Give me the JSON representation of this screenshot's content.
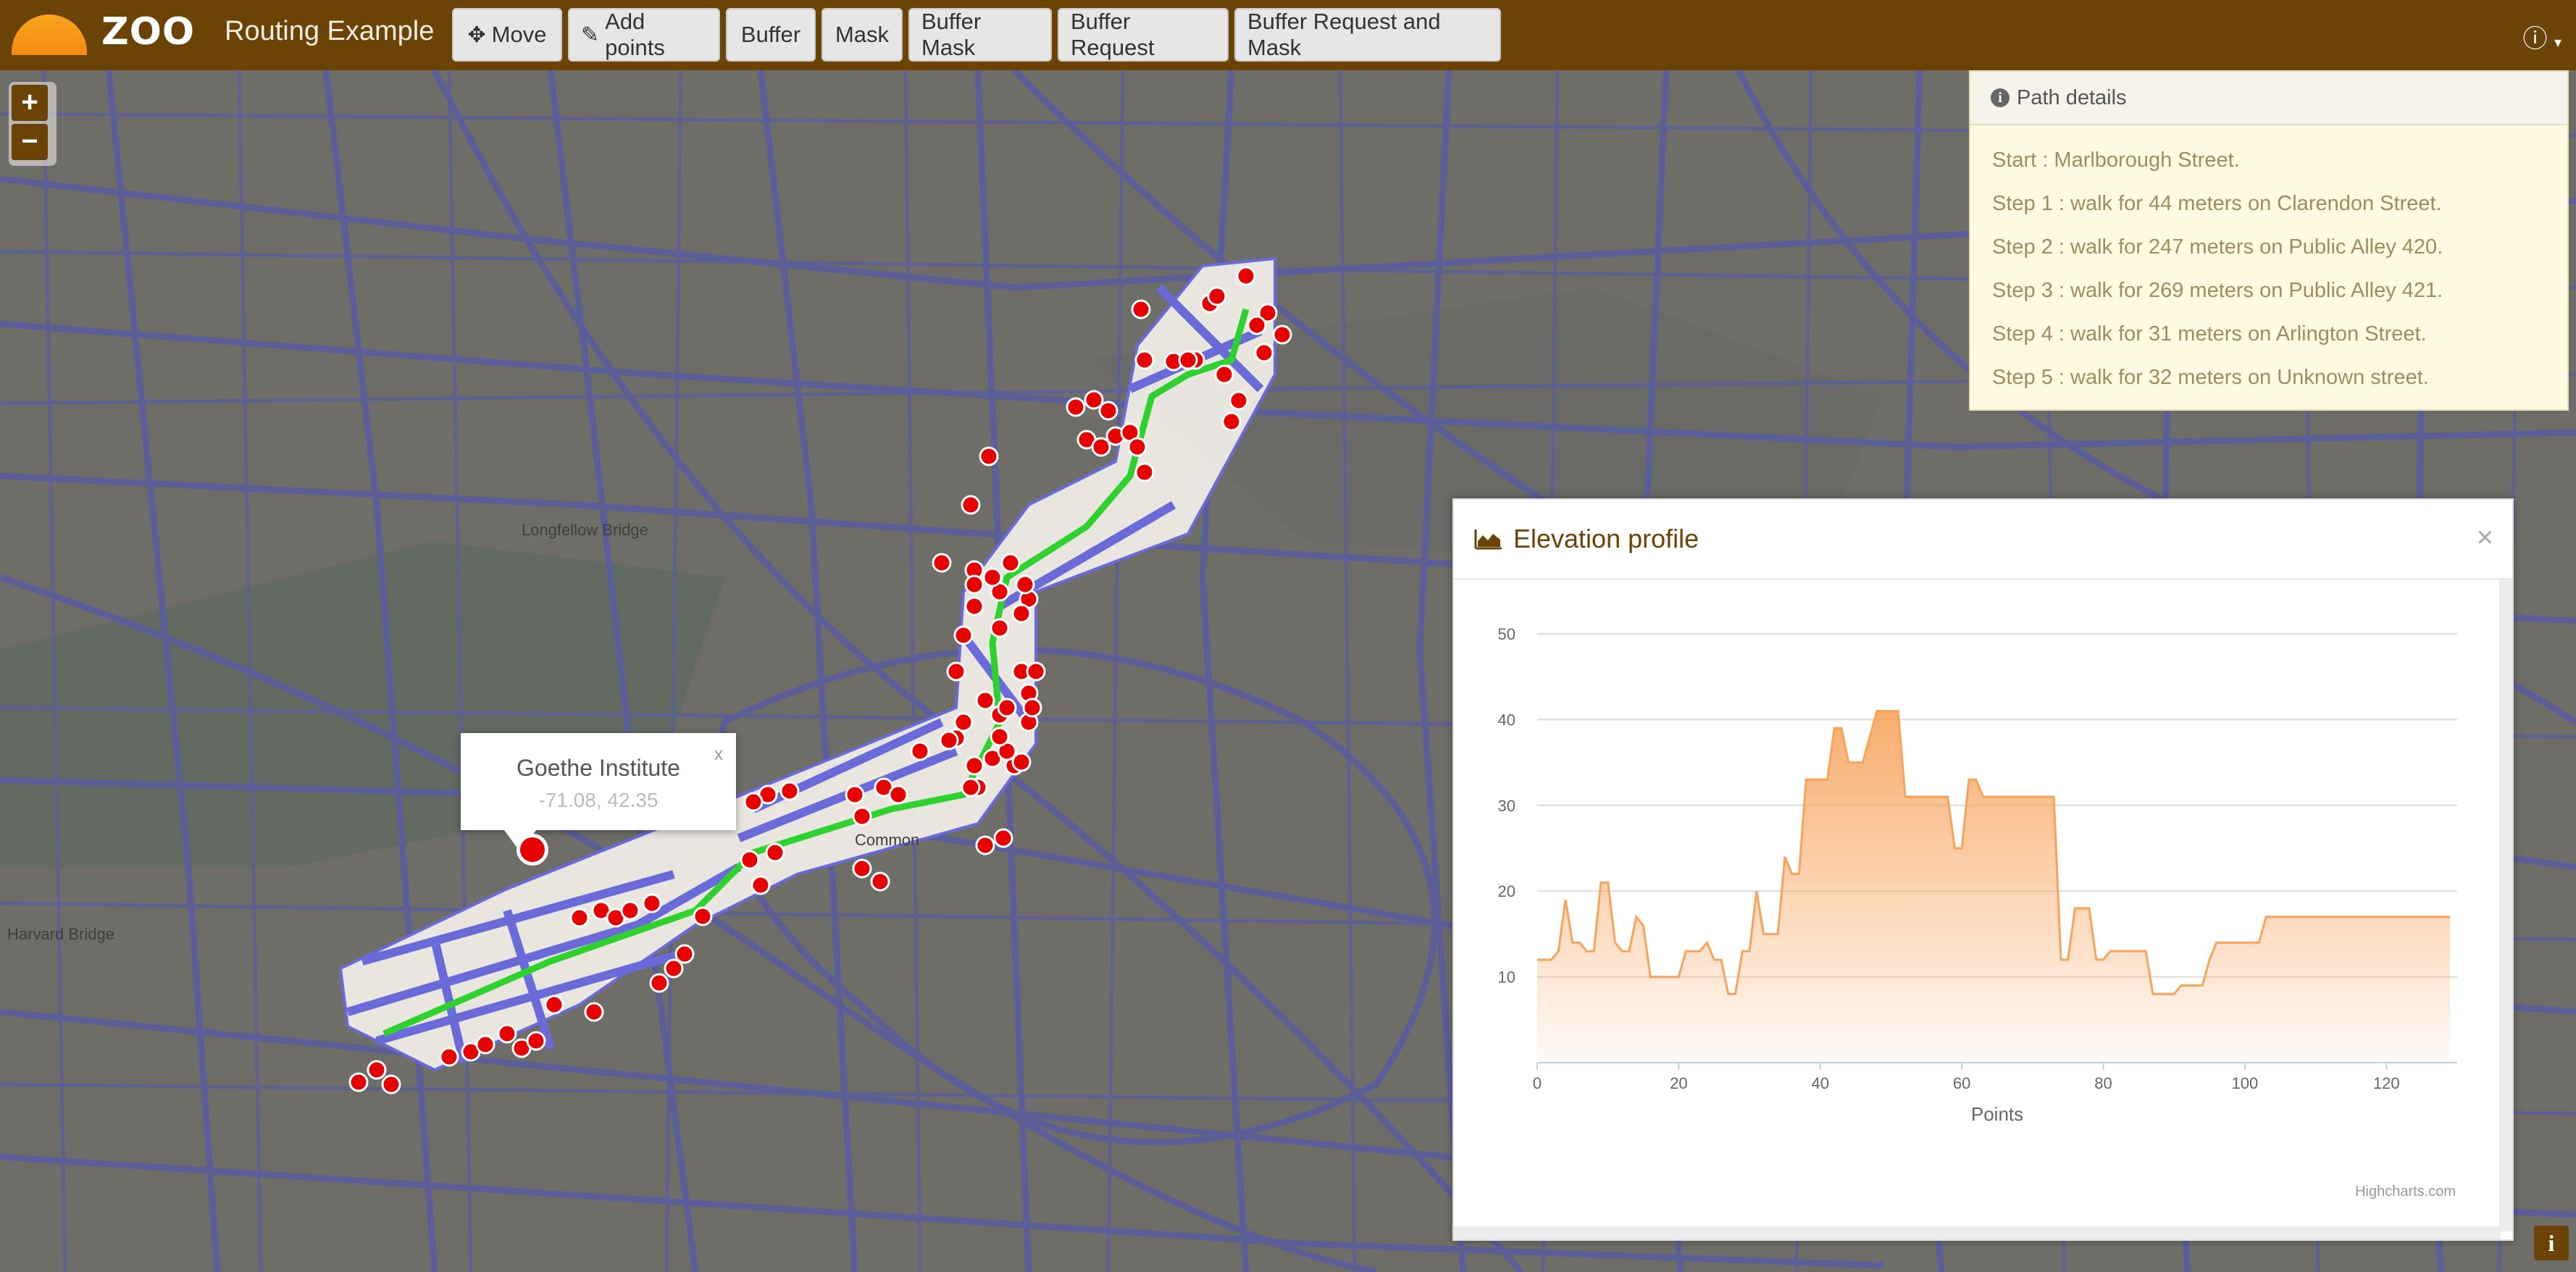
{
  "app": {
    "brand": "ZOO",
    "title": "Routing Example"
  },
  "toolbar": {
    "buttons": [
      {
        "label": "Move",
        "icon": "move-icon"
      },
      {
        "label": "Add points",
        "icon": "pencil-icon"
      },
      {
        "label": "Buffer"
      },
      {
        "label": "Mask"
      },
      {
        "label": "Buffer Mask"
      },
      {
        "label": "Buffer Request"
      },
      {
        "label": "Buffer Request and Mask"
      }
    ],
    "info_icon": "info-icon"
  },
  "zoom": {
    "in_label": "+",
    "out_label": "−"
  },
  "path_details": {
    "title": "Path details",
    "steps": [
      "Start : Marlborough Street.",
      "Step 1 : walk for 44 meters on Clarendon Street.",
      "Step 2 : walk for 247 meters on Public Alley 420.",
      "Step 3 : walk for 269 meters on Public Alley 421.",
      "Step 4 : walk for 31 meters on Arlington Street.",
      "Step 5 : walk for 32 meters on Unknown street."
    ]
  },
  "popup": {
    "name": "Goethe Institute",
    "coords": "-71.08, 42.35",
    "close": "x"
  },
  "elevation": {
    "title": "Elevation profile",
    "close": "×",
    "credit": "Highcharts.com"
  },
  "map_labels": {
    "longfellow": "Longfellow Bridge",
    "harvard": "Harvard Bridge",
    "common": "Common"
  },
  "colors": {
    "navbar": "#6b4306",
    "series": "#f7a35c",
    "route": "#2fd12f",
    "buffer": "#6a6ad8",
    "point": "#e60000"
  },
  "chart_data": {
    "type": "area",
    "xlabel": "Points",
    "ylabel": "",
    "xlim": [
      0,
      130
    ],
    "ylim": [
      0,
      50
    ],
    "xticks": [
      0,
      20,
      40,
      60,
      80,
      100,
      120
    ],
    "yticks": [
      10,
      20,
      30,
      40,
      50
    ],
    "series": [
      {
        "x": [
          0,
          2,
          3,
          4,
          5,
          6,
          7,
          8,
          9,
          10,
          11,
          12,
          13,
          14,
          15,
          16,
          17,
          18,
          19,
          20,
          21,
          22,
          23,
          24,
          25,
          26,
          27,
          28,
          29,
          30,
          31,
          32,
          33,
          34,
          35,
          36,
          37,
          38,
          39,
          40,
          41,
          42,
          43,
          44,
          45,
          46,
          47,
          48,
          49,
          50,
          51,
          52,
          53,
          54,
          55,
          56,
          57,
          58,
          59,
          60,
          61,
          62,
          63,
          64,
          65,
          66,
          67,
          68,
          69,
          70,
          71,
          72,
          73,
          74,
          75,
          76,
          77,
          78,
          79,
          80,
          81,
          82,
          83,
          84,
          85,
          86,
          87,
          88,
          89,
          90,
          91,
          92,
          93,
          94,
          95,
          96,
          97,
          98,
          99,
          100,
          101,
          102,
          103,
          104,
          105,
          106,
          107,
          108,
          109,
          110,
          111,
          112,
          113,
          114,
          115,
          116,
          117,
          118,
          119,
          120,
          121,
          122,
          123,
          124,
          125,
          126,
          127,
          128,
          129
        ],
        "values": [
          12,
          12,
          13,
          19,
          14,
          14,
          13,
          13,
          21,
          21,
          14,
          13,
          13,
          17,
          16,
          10,
          10,
          10,
          10,
          10,
          13,
          13,
          13,
          14,
          12,
          12,
          8,
          8,
          13,
          13,
          20,
          15,
          15,
          15,
          24,
          22,
          22,
          33,
          33,
          33,
          33,
          39,
          39,
          35,
          35,
          35,
          38,
          41,
          41,
          41,
          41,
          31,
          31,
          31,
          31,
          31,
          31,
          31,
          25,
          25,
          33,
          33,
          31,
          31,
          31,
          31,
          31,
          31,
          31,
          31,
          31,
          31,
          31,
          12,
          12,
          18,
          18,
          18,
          12,
          12,
          13,
          13,
          13,
          13,
          13,
          13,
          8,
          8,
          8,
          8,
          9,
          9,
          9,
          9,
          12,
          14,
          14,
          14,
          14,
          14,
          14,
          14,
          17,
          17,
          17,
          17,
          17,
          17,
          17,
          17,
          17,
          17,
          17,
          17,
          17,
          17,
          17,
          17,
          17,
          17,
          17,
          17,
          17,
          17,
          17,
          17,
          17,
          17,
          17
        ]
      }
    ]
  }
}
